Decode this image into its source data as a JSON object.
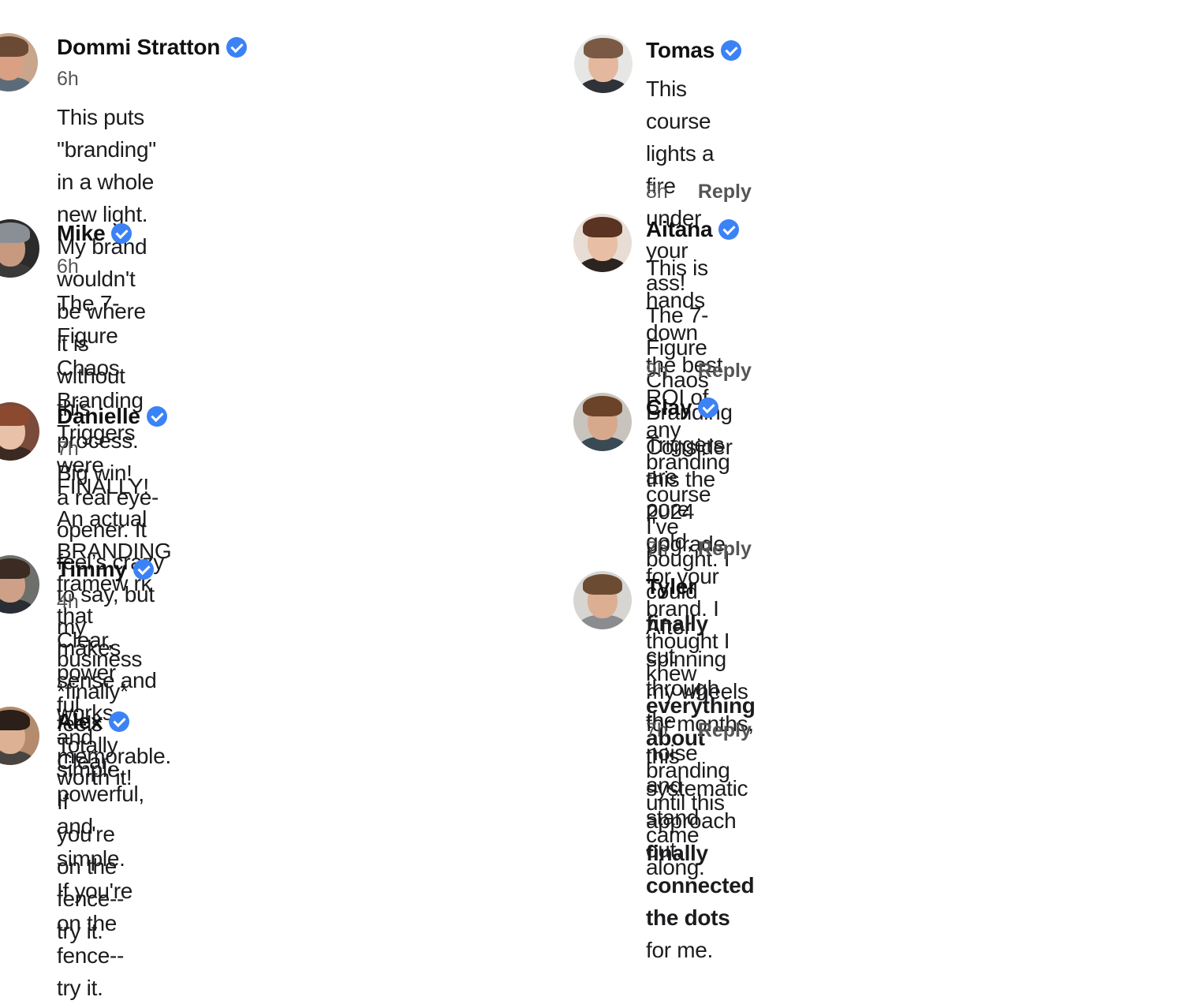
{
  "comments_left": [
    {
      "name": "Dommi Stratton",
      "time": "6h",
      "text": "This puts \"branding\" in a whole new light.\nMy brand wouldn't be where it is without this\nprocess. Big win!"
    },
    {
      "name": "Mike",
      "time": "6h",
      "text": "The 7-Figure Chaos Branding Triggers were\na real eye-opener. It feel’s crazy to say, but\nmy business *finally* feels memorable."
    },
    {
      "name": "Danielle",
      "time": "7h",
      "text": "FINALLY! An actual BRANDING framew rk that\nmakes sense and works. Totally worth it!"
    },
    {
      "name": "Timmy",
      "time": "4h",
      "text": "Clear, power ful, and simple. If you're on the\nfence--try it."
    },
    {
      "name": "Alex",
      "text": "Clear, powerful, and simple.\nIf you're on the fence--try it."
    }
  ],
  "comments_right": [
    {
      "name": "Tomas",
      "text": "This course lights a fire under your ass!\nThe 7-Figure Chaos Branding Triggers are\npure gold,",
      "time": "8h",
      "reply": "Reply"
    },
    {
      "name": "Aitana",
      "text_a": "This is hands down the best ROI of any\nbranding course I've bought. I could ",
      "text_b": "finally",
      "text_c": "\ncut through the noise and stand out.",
      "time": "9h",
      "reply": "Reply"
    },
    {
      "name": "Clay",
      "text_a": "Consider this the 2024 upgrade for your\nbrand. I thought I knew ",
      "text_b": "everything about",
      "text_c": "\nbranding until this came along.",
      "time": "7h",
      "reply": "Reply"
    },
    {
      "name": "Tyler",
      "text_a": "After spinning my wheels for months, this\nsystematic approach ",
      "text_b": "finally connected\nthe dots",
      "text_c": " for me.",
      "time": "7h",
      "reply": "Reply"
    }
  ],
  "colors": {
    "verified_badge": "#3b82f6",
    "text": "#1c1c1e",
    "muted": "#555555"
  }
}
